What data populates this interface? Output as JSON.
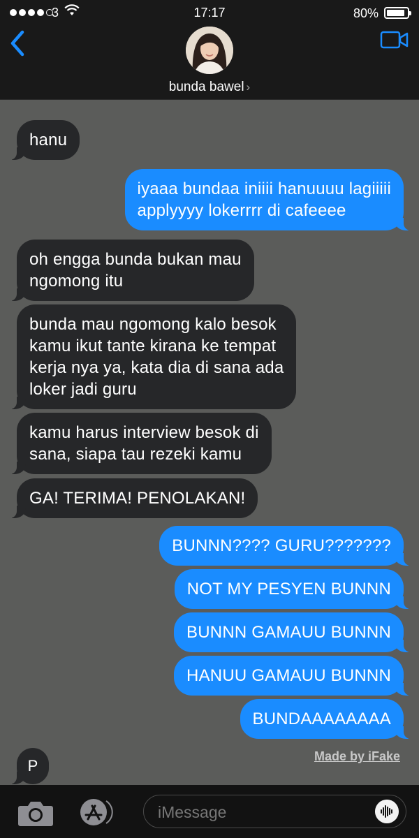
{
  "status_bar": {
    "carrier": "3",
    "time": "17:17",
    "battery_percent": "80%",
    "signal_bars": 4,
    "battery_level": 0.8
  },
  "header": {
    "back_icon": "chevron-left-icon",
    "video_icon": "video-camera-icon",
    "contact_name": "bunda bawel",
    "contact_chevron": "›",
    "accent_color": "#1a8cff"
  },
  "messages": [
    {
      "from": "them",
      "lines": [
        "hanu"
      ]
    },
    {
      "from": "me",
      "lines": [
        "iyaaa bundaa iniiii hanuuuu lagiiiii",
        "applyyyy lokerrrr di cafeeee"
      ]
    },
    {
      "from": "them",
      "lines": [
        "oh engga bunda bukan mau",
        "ngomong itu"
      ]
    },
    {
      "from": "them",
      "lines": [
        "bunda mau ngomong kalo besok",
        "kamu ikut tante kirana ke tempat",
        "kerja nya ya, kata dia di sana ada",
        "loker jadi guru"
      ]
    },
    {
      "from": "them",
      "lines": [
        "kamu harus interview besok di",
        "sana, siapa tau rezeki kamu"
      ]
    },
    {
      "from": "them",
      "lines": [
        "GA! TERIMA! PENOLAKAN!"
      ]
    },
    {
      "from": "me",
      "lines": [
        "BUNNN???? GURU???????"
      ]
    },
    {
      "from": "me",
      "lines": [
        "NOT MY PESYEN BUNNN"
      ]
    },
    {
      "from": "me",
      "lines": [
        "BUNNN GAMAUU BUNNN"
      ]
    },
    {
      "from": "me",
      "lines": [
        "HANUU GAMAUU BUNNN"
      ]
    },
    {
      "from": "me",
      "lines": [
        "BUNDAAAAAAAA"
      ]
    }
  ],
  "typing_bubble": {
    "text": "P"
  },
  "watermark": "Made by iFake",
  "composer": {
    "placeholder": "iMessage",
    "camera_icon": "camera-icon",
    "appstore_icon": "app-store-icon",
    "audio_icon": "audio-waveform-icon"
  }
}
